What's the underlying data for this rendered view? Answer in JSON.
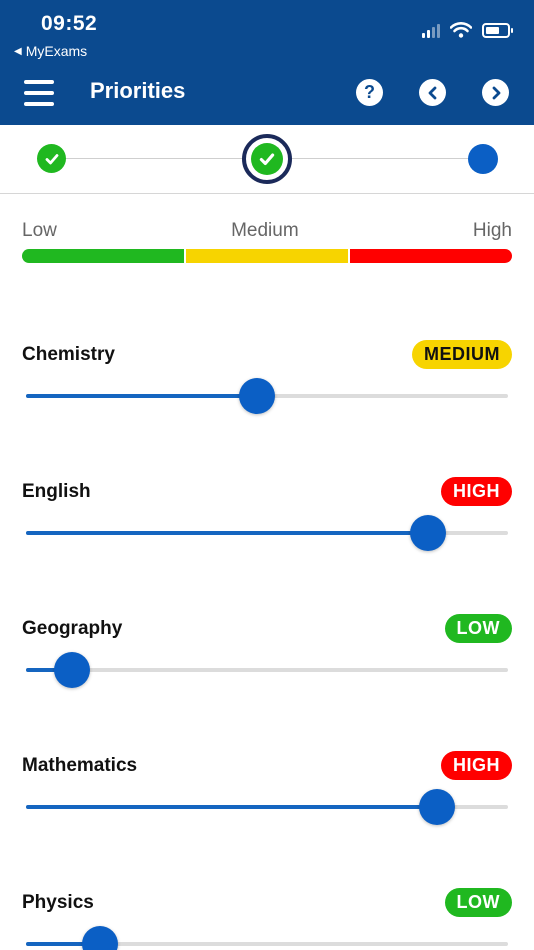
{
  "status_bar": {
    "time": "09:52",
    "back_app": "MyExams"
  },
  "header": {
    "title": "Priorities",
    "help_icon": "?",
    "prev_icon": "‹",
    "next_icon": "›"
  },
  "legend": {
    "labels": [
      "Low",
      "Medium",
      "High"
    ],
    "colors": [
      "#20b820",
      "#f7d400",
      "#ff0000"
    ]
  },
  "subjects": [
    {
      "name": "Chemistry",
      "priority": "MEDIUM",
      "value": 0.48
    },
    {
      "name": "English",
      "priority": "HIGH",
      "value": 0.835
    },
    {
      "name": "Geography",
      "priority": "LOW",
      "value": 0.095
    },
    {
      "name": "Mathematics",
      "priority": "HIGH",
      "value": 0.852
    },
    {
      "name": "Physics",
      "priority": "LOW",
      "value": 0.153
    }
  ],
  "priority_colors": {
    "LOW": {
      "bg": "#20b820",
      "fg": "#ffffff"
    },
    "MEDIUM": {
      "bg": "#f7d400",
      "fg": "#111111"
    },
    "HIGH": {
      "bg": "#ff0000",
      "fg": "#ffffff"
    }
  }
}
